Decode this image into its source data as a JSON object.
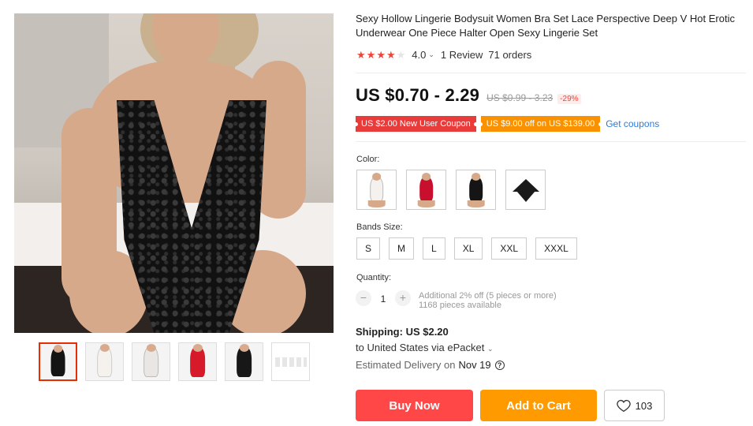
{
  "product": {
    "title": "Sexy Hollow Lingerie Bodysuit Women Bra Set Lace Perspective Deep V Hot Erotic Underwear One Piece Halter Open Sexy Lingerie Set",
    "rating": "4.0",
    "rating_stars": 4,
    "reviews": "1 Review",
    "orders": "71 orders"
  },
  "price": {
    "current": "US $0.70 - 2.29",
    "original": "US $0.99 - 3.23",
    "discount": "-29%"
  },
  "coupons": {
    "new_user": "US $2.00 New User Coupon",
    "store": "US $9.00 off on US $139.00",
    "get_label": "Get coupons"
  },
  "color": {
    "label": "Color:",
    "options": [
      "white-lace",
      "red-lace",
      "black-lace",
      "black-set"
    ]
  },
  "size": {
    "label": "Bands Size:",
    "options": [
      "S",
      "M",
      "L",
      "XL",
      "XXL",
      "XXXL"
    ]
  },
  "quantity": {
    "label": "Quantity:",
    "minus": "−",
    "plus": "+",
    "value": "1",
    "note": "Additional 2% off (5 pieces or more)",
    "available": "1168 pieces available"
  },
  "shipping": {
    "label": "Shipping:",
    "price": "US $2.20",
    "destination": "to United States via ePacket",
    "delivery_label": "Estimated Delivery on",
    "delivery_date": "Nov 19"
  },
  "actions": {
    "buy": "Buy Now",
    "cart": "Add to Cart",
    "wishlist_count": "103"
  },
  "colors": {
    "price_red": "#ff4747",
    "coupon_red": "#ea3b3b",
    "coupon_orange": "#fa9100",
    "cart_orange": "#ff9a00",
    "link_blue": "#2f7bd5",
    "star_red": "#f44336"
  },
  "icons": {
    "rating_chevron": "chevron-down-icon",
    "help": "question-icon",
    "wishlist": "heart-icon"
  }
}
